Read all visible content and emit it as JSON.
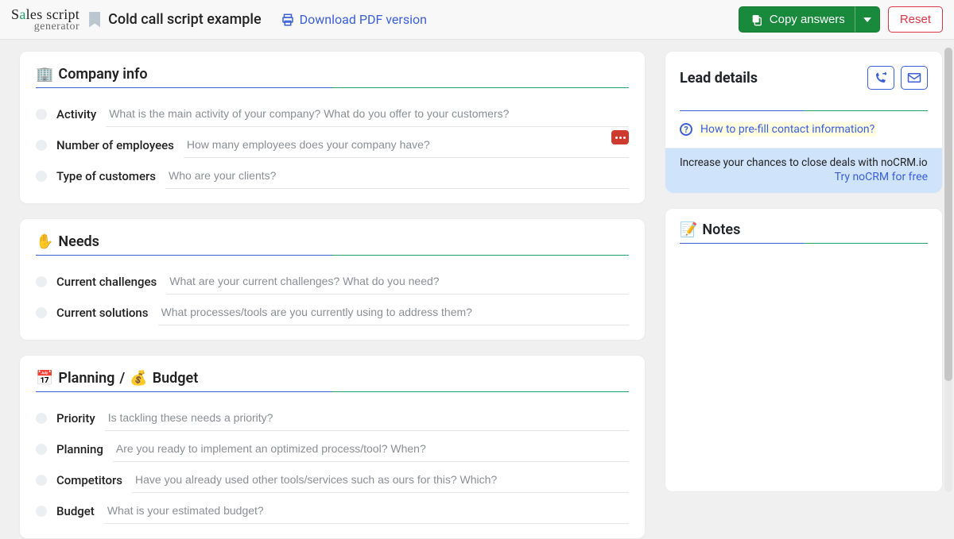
{
  "header": {
    "logo_top_before": "S",
    "logo_top_accent": "a",
    "logo_top_after": "les script",
    "logo_bottom": "generator",
    "page_title": "Cold call script example",
    "download_label": "Download PDF version",
    "copy_label": "Copy answers",
    "reset_label": "Reset"
  },
  "sections": {
    "company": {
      "icon": "🏢",
      "title": "Company info",
      "fields": [
        {
          "label": "Activity",
          "placeholder": "What is the main activity of your company? What do you offer to your customers?"
        },
        {
          "label": "Number of employees",
          "placeholder": "How many employees does your company have?",
          "more": true
        },
        {
          "label": "Type of customers",
          "placeholder": "Who are your clients?"
        }
      ]
    },
    "needs": {
      "icon": "✋",
      "title": "Needs",
      "fields": [
        {
          "label": "Current challenges",
          "placeholder": "What are your current challenges? What do you need?"
        },
        {
          "label": "Current solutions",
          "placeholder": "What processes/tools are you currently using to address them?"
        }
      ]
    },
    "planning": {
      "icon": "📅",
      "title1": "Planning",
      "sep": " / ",
      "icon2": "💰",
      "title2": "Budget",
      "fields": [
        {
          "label": "Priority",
          "placeholder": "Is tackling these needs a priority?"
        },
        {
          "label": "Planning",
          "placeholder": "Are you ready to implement an optimized process/tool? When?"
        },
        {
          "label": "Competitors",
          "placeholder": "Have you already used other tools/services such as ours for this? Which?"
        },
        {
          "label": "Budget",
          "placeholder": "What is your estimated budget?"
        }
      ]
    }
  },
  "lead": {
    "title": "Lead details",
    "prefill_link": "How to pre-fill contact information?",
    "promo_text": "Increase your chances to close deals with noCRM.io",
    "promo_cta": "Try noCRM for free"
  },
  "notes": {
    "icon": "📝",
    "title": "Notes"
  }
}
